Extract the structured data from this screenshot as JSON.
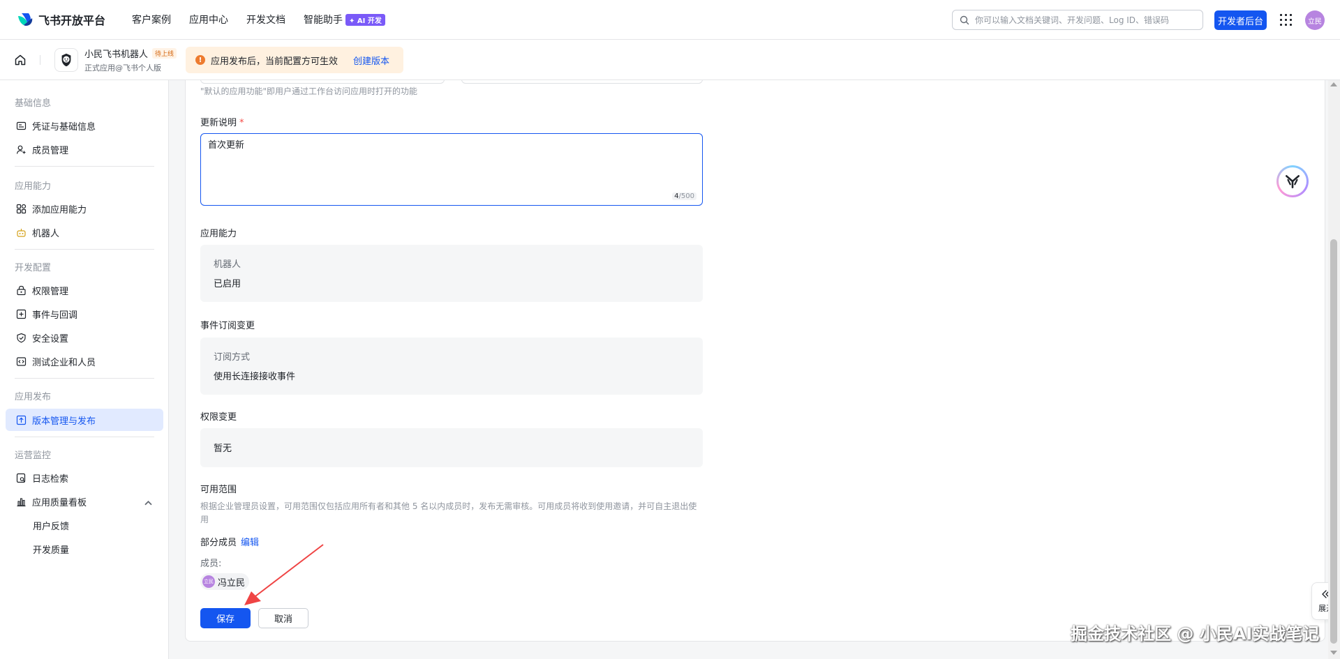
{
  "header": {
    "logo_text": "飞书开放平台",
    "nav": [
      "客户案例",
      "应用中心",
      "开发文档",
      "智能助手"
    ],
    "ai_badge": "✦ AI 开发",
    "search_placeholder": "你可以输入文档关键词、开发问题、Log ID、错误码",
    "dev_console": "开发者后台",
    "avatar_text": "立民"
  },
  "subheader": {
    "app_name": "小民飞书机器人",
    "app_status": "待上线",
    "app_subtitle": "正式应用@飞书个人版",
    "notice_text": "应用发布后，当前配置方可生效",
    "notice_link": "创建版本"
  },
  "sidebar": {
    "sections": [
      {
        "title": "基础信息",
        "items": [
          {
            "label": "凭证与基础信息",
            "icon": "id-card-icon"
          },
          {
            "label": "成员管理",
            "icon": "user-add-icon"
          }
        ]
      },
      {
        "title": "应用能力",
        "items": [
          {
            "label": "添加应用能力",
            "icon": "apps-icon"
          },
          {
            "label": "机器人",
            "icon": "robot-icon"
          }
        ]
      },
      {
        "title": "开发配置",
        "items": [
          {
            "label": "权限管理",
            "icon": "lock-icon"
          },
          {
            "label": "事件与回调",
            "icon": "event-icon"
          },
          {
            "label": "安全设置",
            "icon": "shield-icon"
          },
          {
            "label": "测试企业和人员",
            "icon": "code-icon"
          }
        ]
      },
      {
        "title": "应用发布",
        "items": [
          {
            "label": "版本管理与发布",
            "icon": "upload-icon",
            "active": true
          }
        ]
      },
      {
        "title": "运营监控",
        "items": [
          {
            "label": "日志检索",
            "icon": "log-search-icon"
          },
          {
            "label": "应用质量看板",
            "icon": "bar-chart-icon"
          },
          {
            "label": "用户反馈"
          },
          {
            "label": "开发质量"
          }
        ]
      }
    ]
  },
  "form": {
    "default_hint": "\"默认的应用功能\"即用户通过工作台访问应用时打开的功能",
    "update_label": "更新说明",
    "required_mark": "*",
    "update_value": "首次更新",
    "counter_current": "4",
    "counter_max": "/500",
    "capability_label": "应用能力",
    "capability_key": "机器人",
    "capability_value": "已启用",
    "event_label": "事件订阅变更",
    "event_key": "订阅方式",
    "event_value": "使用长连接接收事件",
    "permission_label": "权限变更",
    "permission_value": "暂无",
    "scope_label": "可用范围",
    "scope_desc": "根据企业管理员设置，可用范围仅包括应用所有者和其他 5 名以内成员时，发布无需审核。可用成员将收到使用邀请，并可自主退出使用",
    "scope_value": "部分成员",
    "edit_link": "编辑",
    "members_label": "成员:",
    "member_avatar": "立民",
    "member_name": "冯立民",
    "save": "保存",
    "cancel": "取消"
  },
  "widgets": {
    "expand": "展开",
    "watermark": "掘金技术社区 @ 小民AI实战笔记"
  },
  "colors": {
    "primary": "#1456f0",
    "active_bg": "#e1eaff",
    "warning": "#ed7b2f",
    "notice_bg": "#fff1e0",
    "annotation_arrow": "#ef4444"
  }
}
